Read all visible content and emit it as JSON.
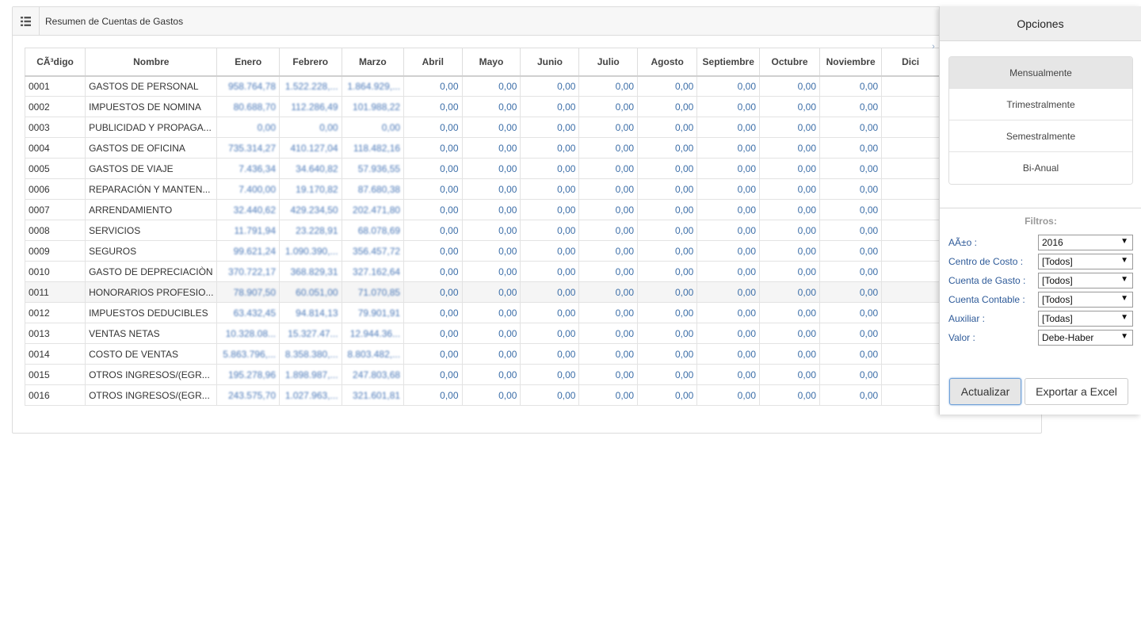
{
  "panel": {
    "title": "Resumen de Cuentas de Gastos",
    "menu_icon": "list-icon",
    "collapse_icon": "chevron-right-icon"
  },
  "table": {
    "columns": [
      "CÃ³digo",
      "Nombre",
      "Enero",
      "Febrero",
      "Marzo",
      "Abril",
      "Mayo",
      "Junio",
      "Julio",
      "Agosto",
      "Septiembre",
      "Octubre",
      "Noviembre",
      "Dici"
    ],
    "rows": [
      {
        "code": "0001",
        "name": "GASTOS DE PERSONAL",
        "values": [
          "958.764,78",
          "1.522.228,...",
          "1.864.929,...",
          "0,00",
          "0,00",
          "0,00",
          "0,00",
          "0,00",
          "0,00",
          "0,00",
          "0,00",
          ""
        ]
      },
      {
        "code": "0002",
        "name": "IMPUESTOS DE NOMINA",
        "values": [
          "80.688,70",
          "112.286,49",
          "101.988,22",
          "0,00",
          "0,00",
          "0,00",
          "0,00",
          "0,00",
          "0,00",
          "0,00",
          "0,00",
          ""
        ]
      },
      {
        "code": "0003",
        "name": "PUBLICIDAD Y PROPAGA...",
        "values": [
          "0,00",
          "0,00",
          "0,00",
          "0,00",
          "0,00",
          "0,00",
          "0,00",
          "0,00",
          "0,00",
          "0,00",
          "0,00",
          ""
        ]
      },
      {
        "code": "0004",
        "name": "GASTOS DE OFICINA",
        "values": [
          "735.314,27",
          "410.127,04",
          "118.482,16",
          "0,00",
          "0,00",
          "0,00",
          "0,00",
          "0,00",
          "0,00",
          "0,00",
          "0,00",
          ""
        ]
      },
      {
        "code": "0005",
        "name": "GASTOS DE VIAJE",
        "values": [
          "7.436,34",
          "34.640,82",
          "57.936,55",
          "0,00",
          "0,00",
          "0,00",
          "0,00",
          "0,00",
          "0,00",
          "0,00",
          "0,00",
          ""
        ]
      },
      {
        "code": "0006",
        "name": "REPARACIÓN Y MANTEN...",
        "values": [
          "7.400,00",
          "19.170,82",
          "87.680,38",
          "0,00",
          "0,00",
          "0,00",
          "0,00",
          "0,00",
          "0,00",
          "0,00",
          "0,00",
          ""
        ]
      },
      {
        "code": "0007",
        "name": "ARRENDAMIENTO",
        "values": [
          "32.440,62",
          "429.234,50",
          "202.471,80",
          "0,00",
          "0,00",
          "0,00",
          "0,00",
          "0,00",
          "0,00",
          "0,00",
          "0,00",
          ""
        ]
      },
      {
        "code": "0008",
        "name": "SERVICIOS",
        "values": [
          "11.791,94",
          "23.228,91",
          "68.078,69",
          "0,00",
          "0,00",
          "0,00",
          "0,00",
          "0,00",
          "0,00",
          "0,00",
          "0,00",
          ""
        ]
      },
      {
        "code": "0009",
        "name": "SEGUROS",
        "values": [
          "99.621,24",
          "1.090.390,...",
          "356.457,72",
          "0,00",
          "0,00",
          "0,00",
          "0,00",
          "0,00",
          "0,00",
          "0,00",
          "0,00",
          ""
        ]
      },
      {
        "code": "0010",
        "name": "GASTO DE DEPRECIACIÒN",
        "values": [
          "370.722,17",
          "368.829,31",
          "327.162,64",
          "0,00",
          "0,00",
          "0,00",
          "0,00",
          "0,00",
          "0,00",
          "0,00",
          "0,00",
          ""
        ]
      },
      {
        "code": "0011",
        "name": "HONORARIOS PROFESIO...",
        "values": [
          "78.907,50",
          "60.051,00",
          "71.070,85",
          "0,00",
          "0,00",
          "0,00",
          "0,00",
          "0,00",
          "0,00",
          "0,00",
          "0,00",
          ""
        ]
      },
      {
        "code": "0012",
        "name": "IMPUESTOS DEDUCIBLES",
        "values": [
          "63.432,45",
          "94.814,13",
          "79.901,91",
          "0,00",
          "0,00",
          "0,00",
          "0,00",
          "0,00",
          "0,00",
          "0,00",
          "0,00",
          ""
        ]
      },
      {
        "code": "0013",
        "name": "VENTAS NETAS",
        "values": [
          "10.328.08...",
          "15.327.47...",
          "12.944.36...",
          "0,00",
          "0,00",
          "0,00",
          "0,00",
          "0,00",
          "0,00",
          "0,00",
          "0,00",
          ""
        ]
      },
      {
        "code": "0014",
        "name": "COSTO DE VENTAS",
        "values": [
          "5.863.796,...",
          "8.358.380,...",
          "8.803.482,...",
          "0,00",
          "0,00",
          "0,00",
          "0,00",
          "0,00",
          "0,00",
          "0,00",
          "0,00",
          ""
        ]
      },
      {
        "code": "0015",
        "name": "OTROS INGRESOS/(EGR...",
        "values": [
          "195.278,96",
          "1.898.987,...",
          "247.803,68",
          "0,00",
          "0,00",
          "0,00",
          "0,00",
          "0,00",
          "0,00",
          "0,00",
          "0,00",
          ""
        ]
      },
      {
        "code": "0016",
        "name": "OTROS INGRESOS/(EGR...",
        "values": [
          "243.575,70",
          "1.027.963,...",
          "321.601,81",
          "0,00",
          "0,00",
          "0,00",
          "0,00",
          "0,00",
          "0,00",
          "0,00",
          "0,00",
          ""
        ]
      }
    ],
    "highlighted_row": "0011"
  },
  "options": {
    "title": "Opciones",
    "periods": [
      "Mensualmente",
      "Trimestralmente",
      "Semestralmente",
      "Bi-Anual"
    ],
    "active_period": "Mensualmente",
    "filters_title": "Filtros:",
    "filters": [
      {
        "label": "AÃ±o :",
        "value": "2016"
      },
      {
        "label": "Centro de Costo :",
        "value": "[Todos]"
      },
      {
        "label": "Cuenta de Gasto :",
        "value": "[Todos]"
      },
      {
        "label": "Cuenta Contable :",
        "value": "[Todos]"
      },
      {
        "label": "Auxiliar :",
        "value": "[Todas]"
      },
      {
        "label": "Valor :",
        "value": "Debe-Haber"
      }
    ],
    "update_label": "Actualizar",
    "export_label": "Exportar a Excel"
  },
  "colors": {
    "number_text": "#3c6ea8",
    "filter_label": "#2f5b99",
    "header_bg": "#eeeeee",
    "active_period_bg": "#e6e6e6"
  }
}
